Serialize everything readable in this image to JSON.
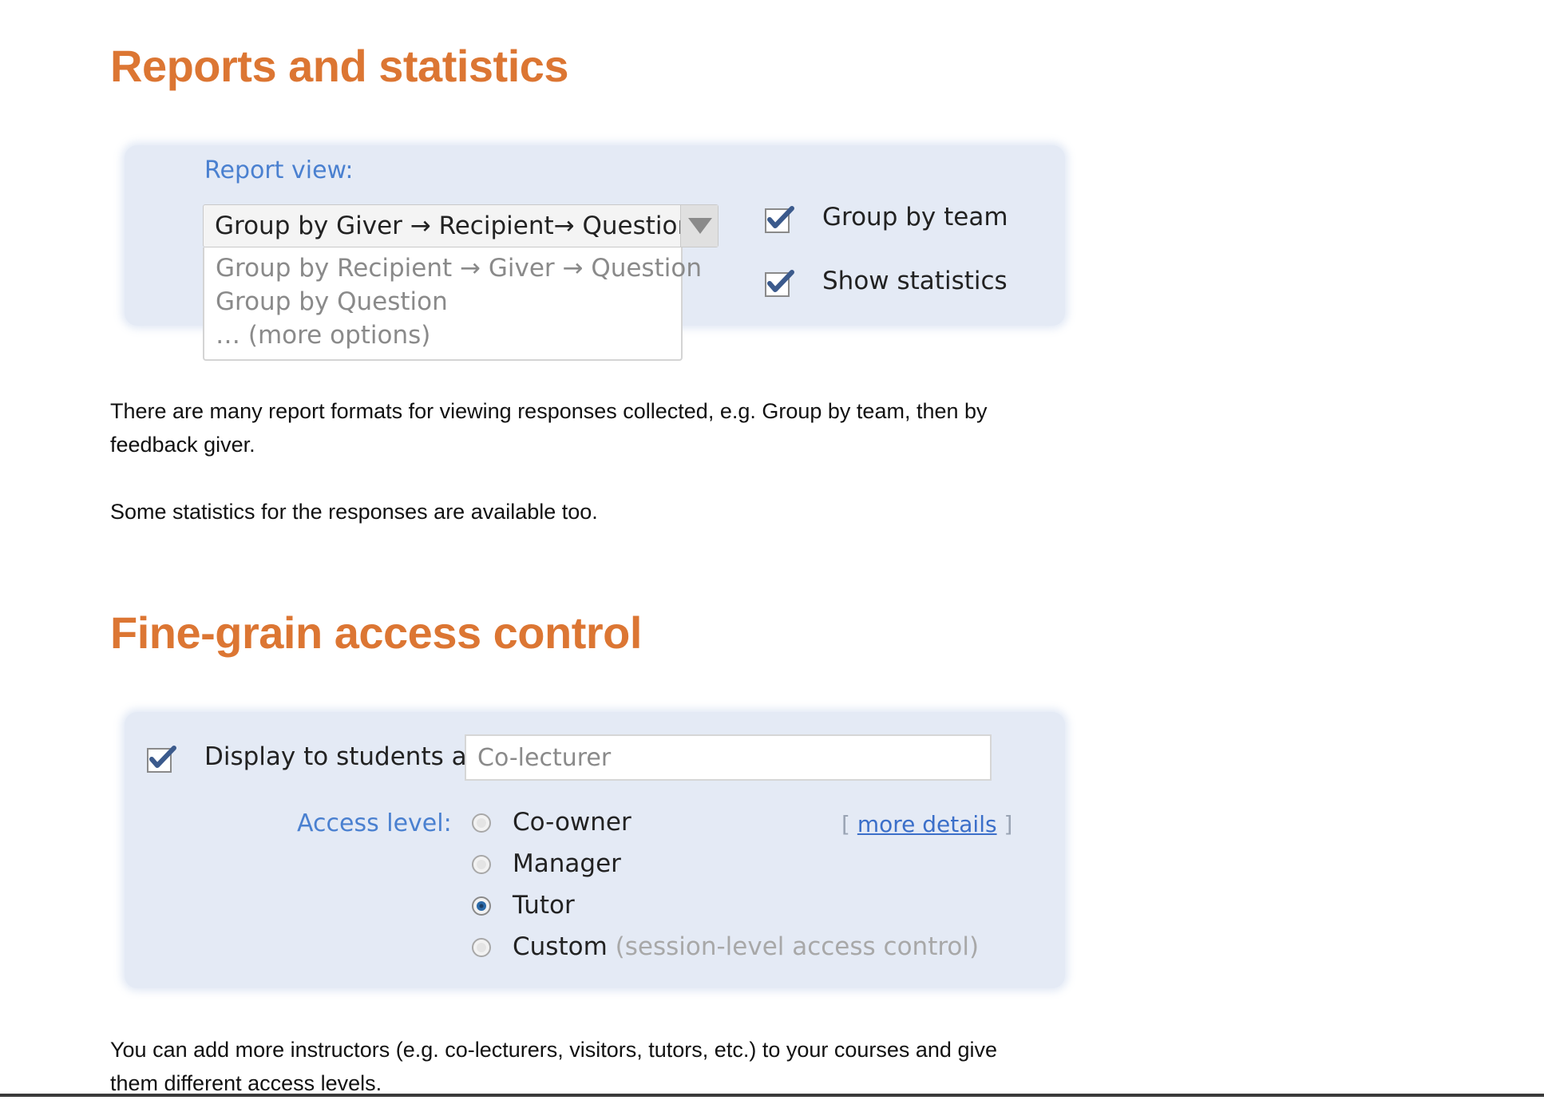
{
  "reports": {
    "heading": "Reports and statistics",
    "report_view_label": "Report view:",
    "selected_option": "Group by Giver → Recipient→ Question",
    "options": [
      "Group by Recipient → Giver → Question",
      "Group by Question",
      "… (more options)"
    ],
    "group_by_team_label": "Group by team",
    "show_statistics_label": "Show statistics",
    "description_1": "There are many report formats for viewing responses collected, e.g. Group by team, then by feedback giver.",
    "description_2": "Some statistics for the responses are available too."
  },
  "access": {
    "heading": "Fine-grain access control",
    "display_label": "Display to students as",
    "display_placeholder": "Co-lecturer",
    "access_level_label": "Access level:",
    "more_details_open": "[",
    "more_details": "more details",
    "more_details_close": "]",
    "levels": [
      "Co-owner",
      "Manager",
      "Tutor",
      "Custom"
    ],
    "custom_note": "(session-level access control)",
    "selected_level": "Tutor",
    "description": "You can add more instructors (e.g. co-lecturers, visitors, tutors, etc.) to your courses and give them different access levels."
  },
  "colors": {
    "heading": "#dc7633",
    "panel": "#e4eaf5",
    "label_blue": "#4a80d0",
    "check": "#3b5a8c"
  }
}
